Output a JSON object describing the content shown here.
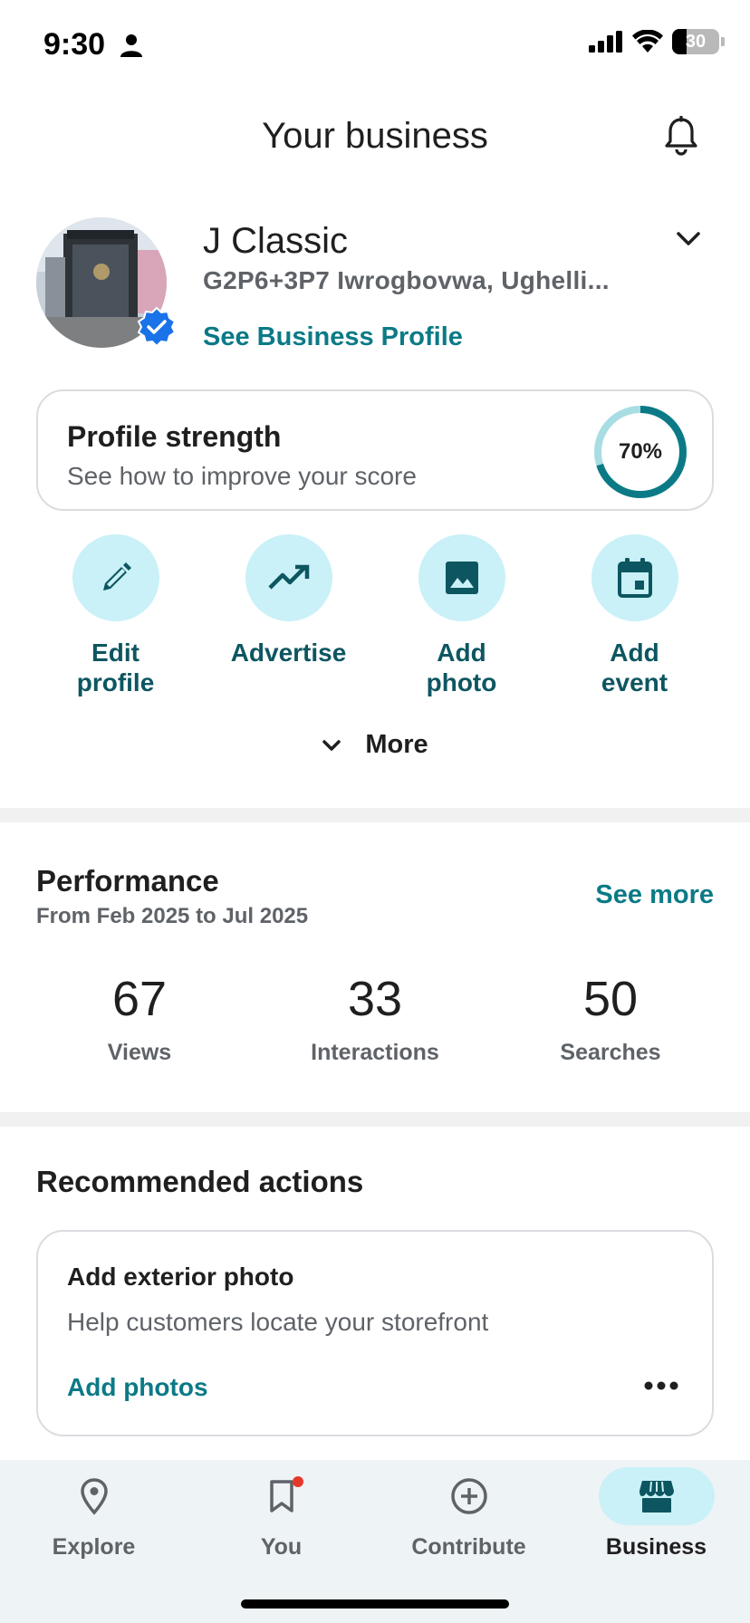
{
  "status_bar": {
    "time": "9:30",
    "battery_level": "30",
    "battery_percent": 30,
    "icons": [
      "person-icon",
      "signal-icon",
      "wifi-icon",
      "battery-icon"
    ]
  },
  "header": {
    "title": "Your business",
    "notifications_icon": "bell-icon"
  },
  "business": {
    "name": "J Classic",
    "address": "G2P6+3P7 Iwrogbovwa, Ughelli...",
    "profile_link": "See Business Profile",
    "verified": true
  },
  "profile_strength": {
    "title": "Profile strength",
    "subtitle": "See how to improve your score",
    "percent_label": "70%",
    "percent_value": 70
  },
  "quick_actions": [
    {
      "line1": "Edit",
      "line2": "profile",
      "icon": "pencil-icon"
    },
    {
      "line1": "Advertise",
      "line2": "",
      "icon": "trending-up-icon"
    },
    {
      "line1": "Add",
      "line2": "photo",
      "icon": "image-icon"
    },
    {
      "line1": "Add",
      "line2": "event",
      "icon": "calendar-icon"
    }
  ],
  "more_label": "More",
  "performance": {
    "title": "Performance",
    "range": "From Feb 2025 to Jul 2025",
    "see_more": "See more",
    "stats": [
      {
        "value": "67",
        "label": "Views"
      },
      {
        "value": "33",
        "label": "Interactions"
      },
      {
        "value": "50",
        "label": "Searches"
      }
    ]
  },
  "recommended": {
    "title": "Recommended actions",
    "card": {
      "title": "Add exterior photo",
      "subtitle": "Help customers locate your storefront",
      "action": "Add photos"
    }
  },
  "bottom_nav": {
    "active": "Business",
    "items": [
      {
        "label": "Explore",
        "icon": "location-pin-icon"
      },
      {
        "label": "You",
        "icon": "bookmark-icon",
        "badge": true
      },
      {
        "label": "Contribute",
        "icon": "add-circle-icon"
      },
      {
        "label": "Business",
        "icon": "storefront-icon"
      }
    ]
  },
  "colors": {
    "accent_teal": "#0b7a86",
    "action_circle": "#c9f1f7",
    "action_label": "#0d5661",
    "verified_blue": "#1a73e8",
    "nav_background": "#eef3f6",
    "badge_red": "#e8372b"
  }
}
